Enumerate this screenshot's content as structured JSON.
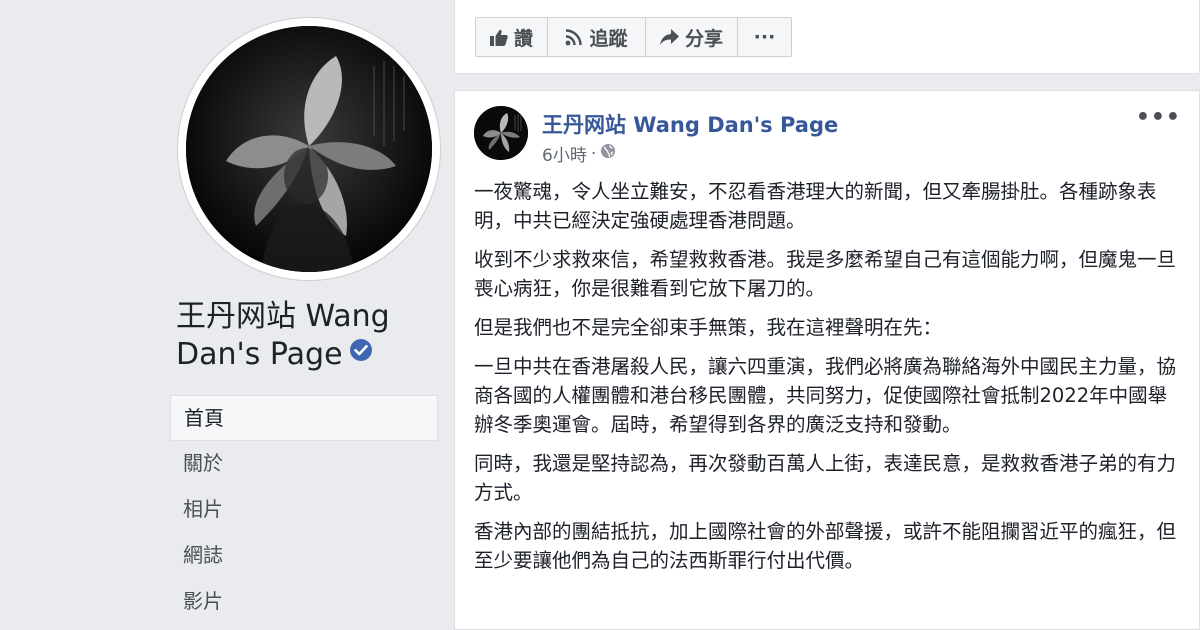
{
  "page": {
    "name": "王丹网站 Wang Dan's Page"
  },
  "nav": {
    "items": [
      {
        "label": "首頁",
        "active": true
      },
      {
        "label": "關於",
        "active": false
      },
      {
        "label": "相片",
        "active": false
      },
      {
        "label": "網誌",
        "active": false
      },
      {
        "label": "影片",
        "active": false
      }
    ]
  },
  "actions": {
    "like_label": "讚",
    "follow_label": "追蹤",
    "share_label": "分享",
    "more_label": "···"
  },
  "post": {
    "author": "王丹网站 Wang Dan's Page",
    "time": "6小時",
    "separator": "·",
    "more_label": "•••",
    "paragraphs": [
      "一夜驚魂，令人坐立難安，不忍看香港理大的新聞，但又牽腸掛肚。各種跡象表明，中共已經決定強硬處理香港問題。",
      "收到不少求救來信，希望救救香港。我是多麼希望自己有這個能力啊，但魔鬼一旦喪心病狂，你是很難看到它放下屠刀的。",
      "但是我們也不是完全卻束手無策，我在這裡聲明在先：",
      "一旦中共在香港屠殺人民，讓六四重演，我們必將廣為聯絡海外中國民主力量，協商各國的人權團體和港台移民團體，共同努力，促使國際社會抵制2022年中國舉辦冬季奧運會。屆時，希望得到各界的廣泛支持和發動。",
      "同時，我還是堅持認為，再次發動百萬人上街，表達民意，是救救香港子弟的有力方式。",
      "香港內部的團結抵抗，加上國際社會的外部聲援，或許不能阻攔習近平的瘋狂，但至少要讓他們為自己的法西斯罪行付出代價。"
    ]
  },
  "colors": {
    "link": "#365899",
    "verified": "#4267b2",
    "background": "#e9ebee"
  },
  "icons": {
    "verified": "verified-badge-icon",
    "like": "thumbs-up-icon",
    "follow": "rss-icon",
    "share": "share-arrow-icon",
    "audience": "globe-icon"
  }
}
